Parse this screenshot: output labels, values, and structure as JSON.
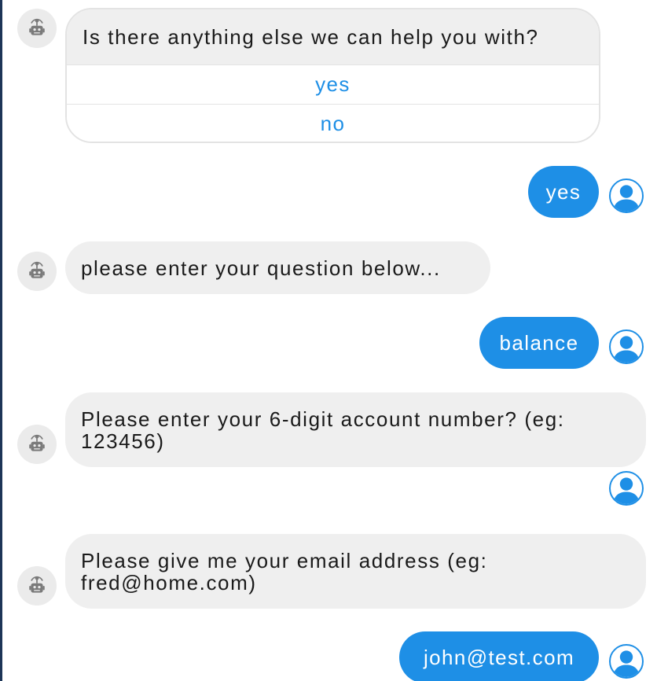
{
  "messages": {
    "m1": {
      "question": "Is there anything else we can help you with?",
      "options": [
        "yes",
        "no"
      ]
    },
    "m2": {
      "text": "yes"
    },
    "m3": {
      "text": "please enter your question below..."
    },
    "m4": {
      "text": "balance"
    },
    "m5": {
      "text": "Please enter your 6-digit account number? (eg: 123456)"
    },
    "m6": {
      "text": "Please give me your email address (eg: fred@home.com)"
    },
    "m7": {
      "text": "john@test.com"
    }
  },
  "icons": {
    "bot": "robot-icon",
    "user": "user-icon"
  },
  "colors": {
    "accent": "#1e8fe6",
    "bot_bubble": "#efefef",
    "bot_avatar_bg": "#ebebeb"
  }
}
